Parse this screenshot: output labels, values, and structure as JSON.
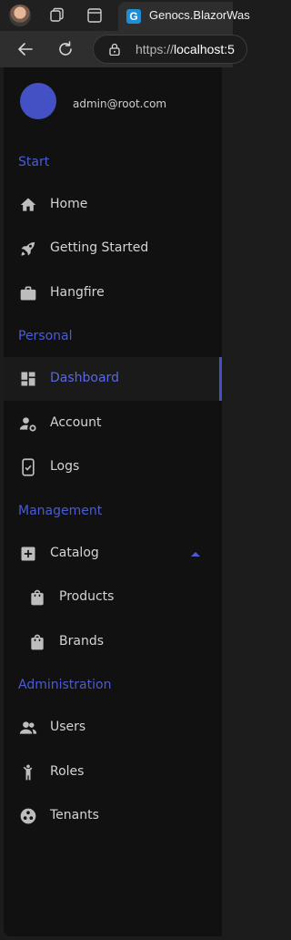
{
  "browser": {
    "tab_title": "Genocs.BlazorWas",
    "favicon_letter": "G",
    "url_prefix": "https://",
    "url_host": "localhost:5"
  },
  "user": {
    "email": "admin@root.com"
  },
  "sections": {
    "start": "Start",
    "personal": "Personal",
    "management": "Management",
    "administration": "Administration"
  },
  "nav": {
    "home": "Home",
    "getting_started": "Getting Started",
    "hangfire": "Hangfire",
    "dashboard": "Dashboard",
    "account": "Account",
    "logs": "Logs",
    "catalog": "Catalog",
    "products": "Products",
    "brands": "Brands",
    "users": "Users",
    "roles": "Roles",
    "tenants": "Tenants"
  },
  "colors": {
    "accent": "#4351c4",
    "section_text": "#4b5bd6",
    "drawer_bg": "#111111"
  }
}
